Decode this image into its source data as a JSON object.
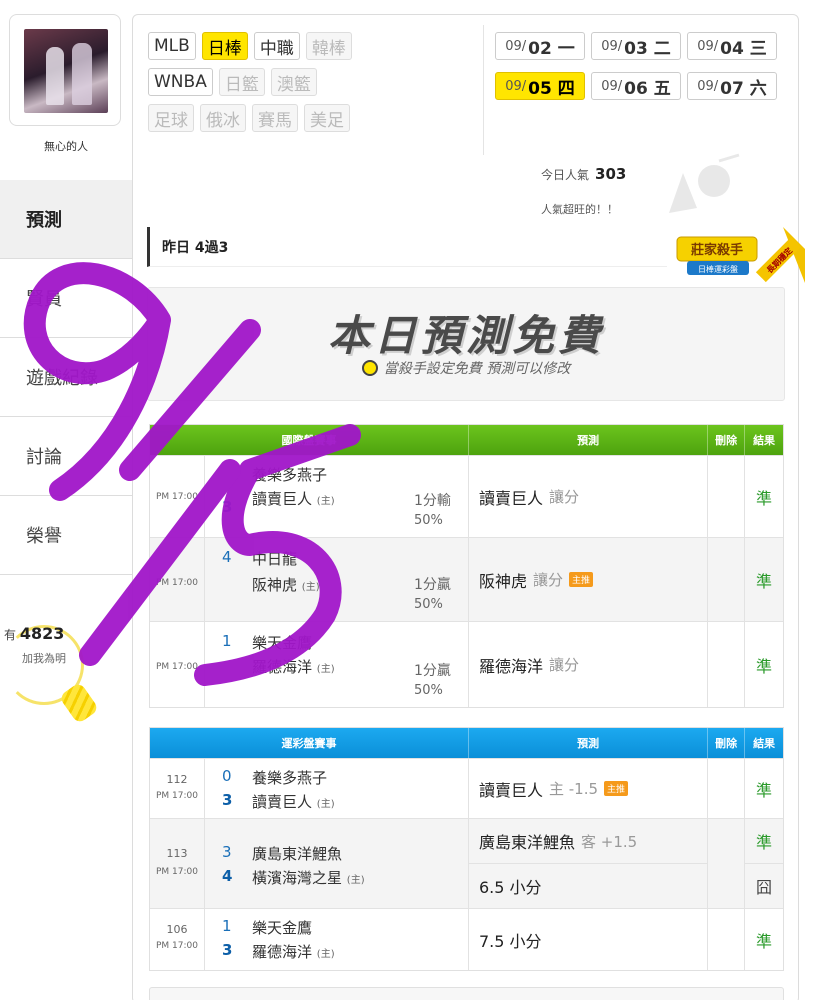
{
  "user": {
    "name": "無心的人"
  },
  "sidebar": {
    "items": [
      {
        "label": "預測"
      },
      {
        "label": "賢員"
      },
      {
        "label": "遊戲紀錄"
      },
      {
        "label": "討論"
      },
      {
        "label": "榮譽"
      }
    ],
    "fans_prefix": "有",
    "fans_count": "4823",
    "fans_note": "加我為明"
  },
  "leagues": {
    "row1": [
      "MLB",
      "日棒",
      "中職",
      "韓棒"
    ],
    "row2": [
      "WNBA",
      "日籃",
      "澳籃"
    ],
    "row3": [
      "足球",
      "俄冰",
      "賽馬",
      "美足"
    ]
  },
  "dates": [
    {
      "md": "09/",
      "day": "02 一"
    },
    {
      "md": "09/",
      "day": "03 二"
    },
    {
      "md": "09/",
      "day": "04 三"
    },
    {
      "md": "09/",
      "day": "05 四"
    },
    {
      "md": "09/",
      "day": "06 五"
    },
    {
      "md": "09/",
      "day": "07 六"
    }
  ],
  "popularity": {
    "label": "今日人氣",
    "value": "303",
    "note": "人氣超旺的！！"
  },
  "record": "昨日 4過3",
  "badge": {
    "title": "莊家殺手",
    "sub": "日棒運彩盤",
    "ribbon": "長期穩定"
  },
  "banner": {
    "title": "本日預測免費",
    "subtitle": "當殺手設定免費 預測可以修改"
  },
  "table1": {
    "headers": {
      "game": "國際盤賽事",
      "pred": "預測",
      "del": "刪除",
      "res": "結果"
    },
    "rows": [
      {
        "time": "PM 17:00",
        "s1": "",
        "s2": "3",
        "t1": "養樂多燕子",
        "t2": "讀賣巨人",
        "home": "(主)",
        "line1": "1分輸",
        "line2": "50%",
        "pred": "讀賣巨人",
        "pred_sub": "讓分",
        "tag": "",
        "result": "準"
      },
      {
        "time": "PM 17:00",
        "s1": "4",
        "s2": "",
        "t1": "中日龍",
        "t2": "阪神虎",
        "home": "(主)",
        "line1": "1分贏",
        "line2": "50%",
        "pred": "阪神虎",
        "pred_sub": "讓分",
        "tag": "主推",
        "result": "準"
      },
      {
        "time": "PM 17:00",
        "s1": "1",
        "s2": "",
        "t1": "樂天金鷹",
        "t2": "羅德海洋",
        "home": "(主)",
        "line1": "1分贏",
        "line2": "50%",
        "pred": "羅德海洋",
        "pred_sub": "讓分",
        "tag": "",
        "result": "準"
      }
    ]
  },
  "table2": {
    "headers": {
      "game": "運彩盤賽事",
      "pred": "預測",
      "del": "刪除",
      "res": "結果"
    },
    "rows": [
      {
        "no": "112",
        "time": "PM 17:00",
        "s1": "0",
        "s2": "3",
        "t1": "養樂多燕子",
        "t2": "讀賣巨人",
        "home": "(主)",
        "pred": "讀賣巨人",
        "pred_sub": "主 -1.5",
        "tag": "主推",
        "result": "準"
      },
      {
        "no": "113",
        "time": "PM 17:00",
        "s1": "3",
        "s2": "4",
        "t1": "廣島東洋鯉魚",
        "t2": "橫濱海灣之星",
        "home": "(主)",
        "pred_a": "廣島東洋鯉魚",
        "pred_a_sub": "客 +1.5",
        "result_a": "準",
        "pred_b": "6.5 小分",
        "result_b": "囧"
      },
      {
        "no": "106",
        "time": "PM 17:00",
        "s1": "1",
        "s2": "3",
        "t1": "樂天金鷹",
        "t2": "羅德海洋",
        "home": "(主)",
        "pred": "7.5 小分",
        "result": "準"
      }
    ]
  },
  "colors": {
    "accent_yellow": "#ffe500",
    "header_green": "#5ab415",
    "header_blue": "#14a0e6",
    "win_green": "#2a9a2a",
    "scribble": "#a116c9"
  }
}
